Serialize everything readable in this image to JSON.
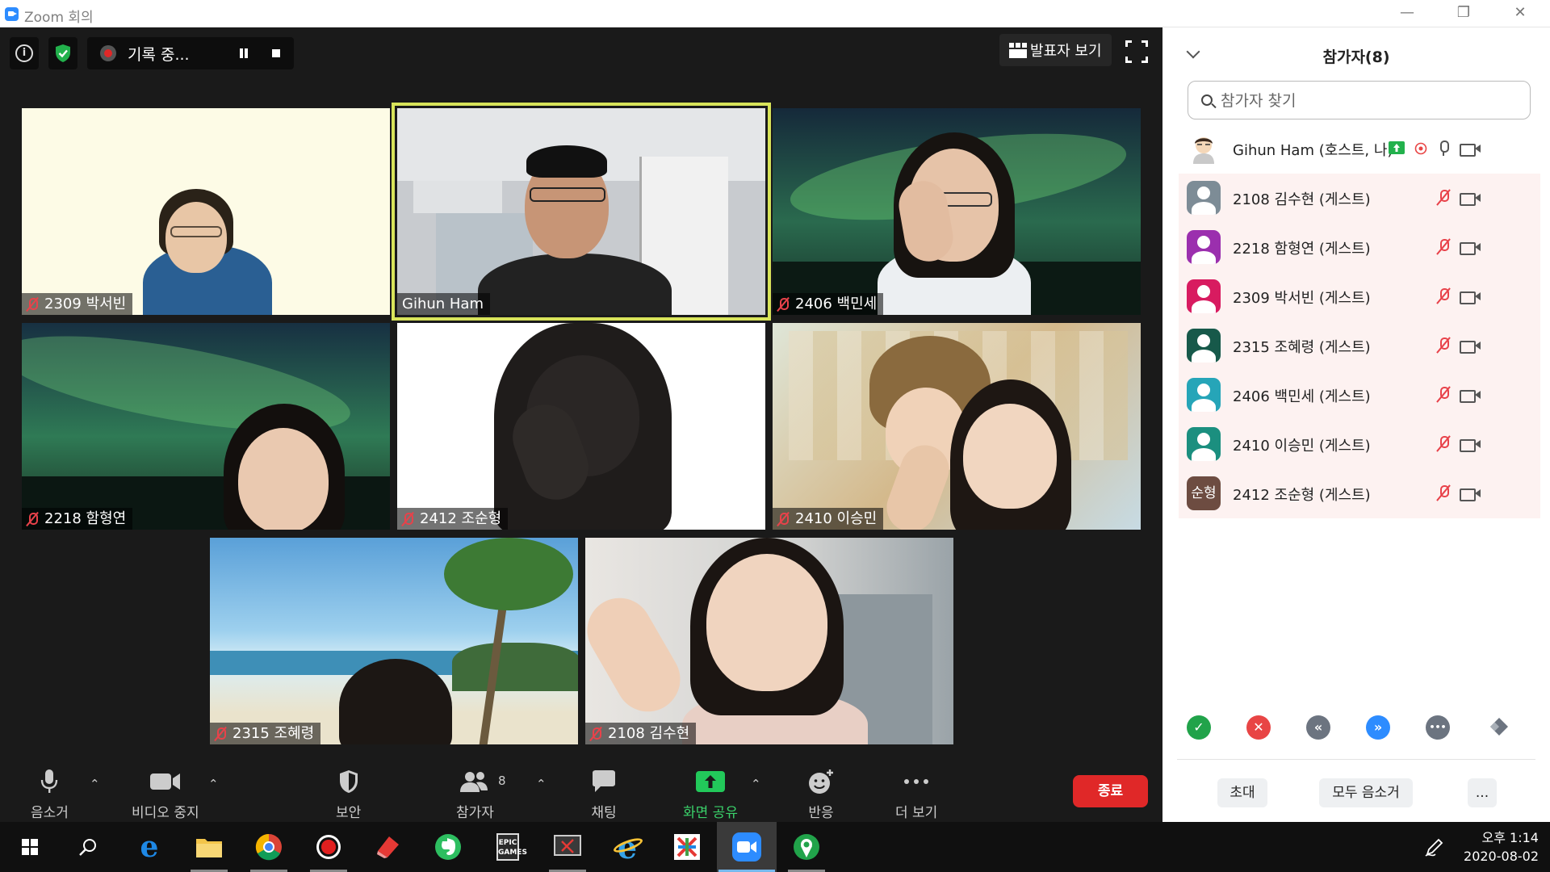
{
  "window": {
    "title": "Zoom 회의",
    "minimize": "—",
    "restore": "❐",
    "close": "✕"
  },
  "top": {
    "recording_label": "기록 중...",
    "speaker_view": "발표자 보기"
  },
  "tiles": [
    {
      "name": "2309 박서빈",
      "muted": true
    },
    {
      "name": "Gihun Ham",
      "muted": false
    },
    {
      "name": "2406 백민세",
      "muted": true
    },
    {
      "name": "2218 함형연",
      "muted": true
    },
    {
      "name": "2412 조순형",
      "muted": true
    },
    {
      "name": "2410 이승민",
      "muted": true
    },
    {
      "name": "2315 조혜령",
      "muted": true
    },
    {
      "name": "2108 김수현",
      "muted": true
    }
  ],
  "toolbar": {
    "mute": "음소거",
    "video": "비디오 중지",
    "security": "보안",
    "participants": "참가자",
    "participants_count": "8",
    "chat": "채팅",
    "share": "화면 공유",
    "reactions": "반응",
    "more": "더 보기",
    "end": "종료"
  },
  "panel": {
    "title": "참가자(8)",
    "search_placeholder": "참가자 찾기",
    "participants": [
      {
        "name": "Gihun Ham (호스트, 나)",
        "avatar_color": "#ffffff",
        "avatar_text": "",
        "muted": false
      },
      {
        "name": "2108 김수현 (게스트)",
        "avatar_color": "#7d8c96",
        "avatar_text": "",
        "muted": true
      },
      {
        "name": "2218 함형연 (게스트)",
        "avatar_color": "#9b2fae",
        "avatar_text": "",
        "muted": true
      },
      {
        "name": "2309 박서빈 (게스트)",
        "avatar_color": "#d81b60",
        "avatar_text": "",
        "muted": true
      },
      {
        "name": "2315 조혜령 (게스트)",
        "avatar_color": "#17594a",
        "avatar_text": "",
        "muted": true
      },
      {
        "name": "2406 백민세 (게스트)",
        "avatar_color": "#26a5b8",
        "avatar_text": "",
        "muted": true
      },
      {
        "name": "2410 이승민 (게스트)",
        "avatar_color": "#1b8f7f",
        "avatar_text": "",
        "muted": true
      },
      {
        "name": "2412 조순형 (게스트)",
        "avatar_color": "#6d4c41",
        "avatar_text": "순형",
        "muted": true
      }
    ],
    "reactions": [
      {
        "icon": "✓",
        "color": "#21a34a"
      },
      {
        "icon": "✕",
        "color": "#e84545"
      },
      {
        "icon": "«",
        "color": "#6c7480"
      },
      {
        "icon": "»",
        "color": "#2d8cff"
      },
      {
        "icon": "•••",
        "color": "#6c7480"
      },
      {
        "icon": "",
        "color": "#6c7480"
      }
    ],
    "invite": "초대",
    "mute_all": "모두 음소거",
    "more": "..."
  },
  "taskbar": {
    "time": "오후 1:14",
    "date": "2020-08-02"
  },
  "colors": {
    "accent": "#2d8cff",
    "active_speaker": "#d8e45a",
    "end": "#e02828",
    "share": "#22c95a"
  }
}
